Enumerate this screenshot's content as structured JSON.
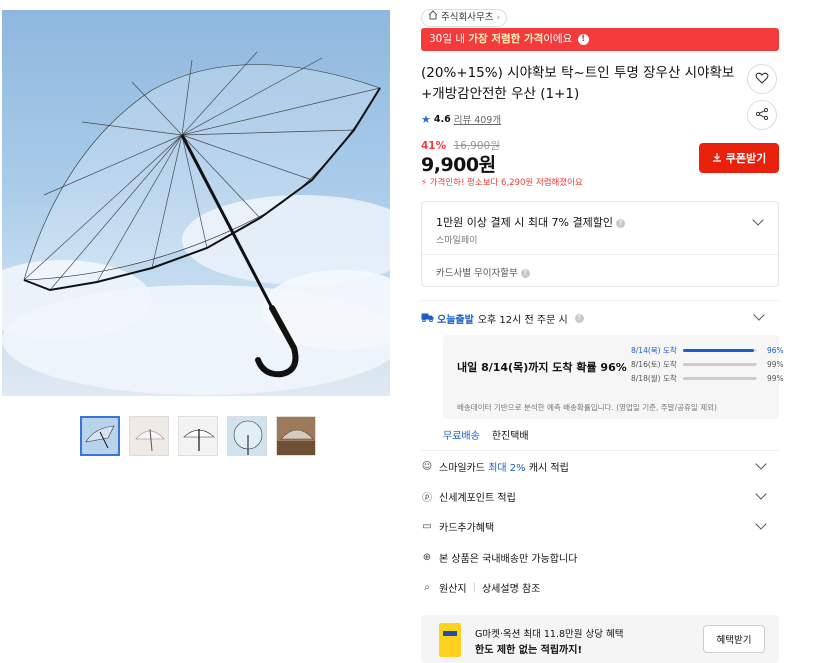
{
  "shop": {
    "name": "주식회사무츠"
  },
  "promo": {
    "prefix": "30일 내 ",
    "highlight": "가장 저렴한 가격",
    "suffix": "이에요"
  },
  "product": {
    "title": "(20%+15%) 시야확보 탁~트인 투명 장우산 시야확보 +개방감안전한 우산 (1+1)",
    "rating": "4.6",
    "reviews": "리뷰 409개",
    "discount_rate": "41%",
    "original_price": "16,900원",
    "price": "9,900원",
    "lowest_note": "가격인하! 평소보다 6,290원 저렴해졌어요"
  },
  "coupon": {
    "label": "쿠폰받기"
  },
  "benefit": {
    "main": "1만원 이상 결제 시 최대 7% 결제할인",
    "sub": "스마일페이",
    "card": "카드사별 무이자할부"
  },
  "shipping": {
    "badge": "오늘출발",
    "text": "오후 12시 전 주문 시",
    "arrival": "내일 8/14(목)까지 도착 확률 96%",
    "rows": [
      {
        "date": "8/14(목) 도착",
        "pct": "96%",
        "value": 0.96,
        "highlight": true
      },
      {
        "date": "8/16(토) 도착",
        "pct": "99%",
        "value": 0.99,
        "highlight": false
      },
      {
        "date": "8/18(월) 도착",
        "pct": "99%",
        "value": 0.99,
        "highlight": false
      }
    ],
    "note": "배송데이터 기반으로 분석한 예측 배송확률입니다. (영업일 기준, 주말/공휴일 제외)",
    "carrier_free": "무료배송",
    "carrier_name": "한진택배"
  },
  "list": {
    "smile_card": {
      "prefix": "스마일카드 ",
      "highlight": "최대 2%",
      "suffix": " 캐시 적립"
    },
    "shinsegae": "신세계포인트 적립",
    "card_extra": "카드추가혜택",
    "domestic": "본 상품은 국내배송만 가능합니다",
    "origin_label": "원산지",
    "origin_value": "상세설명 참조"
  },
  "gmarket": {
    "line1": "G마켓·옥션 최대 11.8만원 상당 혜택",
    "line2": "한도 제한 없는 적립까지!",
    "button": "혜택받기"
  },
  "colors": {
    "accent_red": "#f43b3b",
    "coupon_red": "#e8200c",
    "blue": "#1a5ec9",
    "sky": "#a8cbe9"
  },
  "icons": [
    "home-icon",
    "info-icon",
    "heart-icon",
    "share-icon",
    "star-icon",
    "download-icon",
    "chevron-down-icon",
    "truck-icon",
    "smile-icon",
    "point-icon",
    "card-icon",
    "globe-icon",
    "search-icon"
  ]
}
